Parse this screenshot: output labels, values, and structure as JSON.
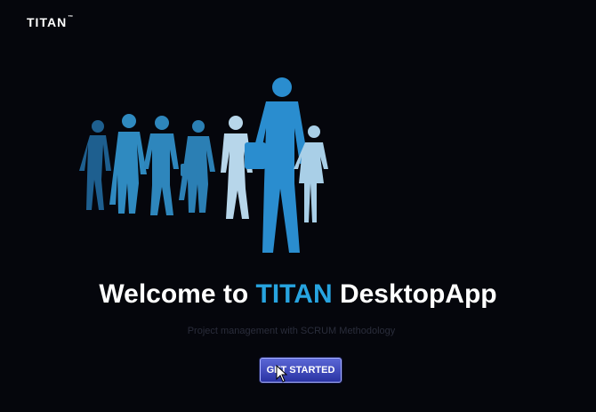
{
  "brand": {
    "logo_text": "TITAN",
    "trademark": "™"
  },
  "hero": {
    "image_name": "team-silhouettes"
  },
  "welcome": {
    "prefix": "Welcome to ",
    "accent": "TITAN",
    "suffix": " DesktopApp"
  },
  "subtitle": "Project management with SCRUM Methodology",
  "cta": {
    "label": "GET STARTED"
  },
  "colors": {
    "background": "#05060c",
    "accent": "#27a4e0",
    "button": "#3b45c0"
  }
}
